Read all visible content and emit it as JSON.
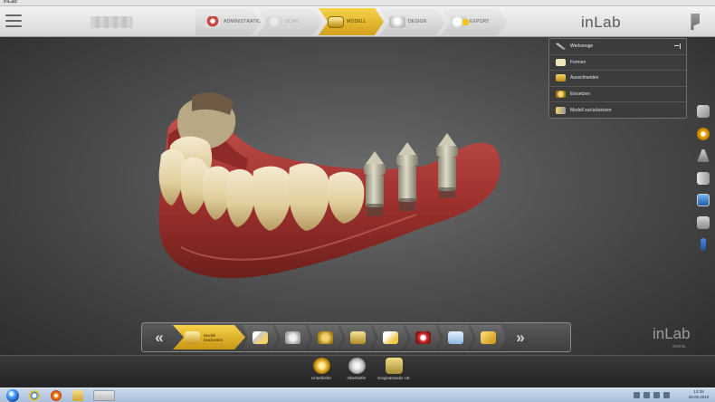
{
  "window": {
    "title": "inLab"
  },
  "header": {
    "brand": "inLab",
    "phases": [
      {
        "id": "administration",
        "label": "ADMINISTRATION",
        "state": "normal",
        "icon": "administration-icon"
      },
      {
        "id": "scan",
        "label": "SCAN",
        "state": "disabled",
        "icon": "scan-icon"
      },
      {
        "id": "model",
        "label": "MODELL",
        "state": "active",
        "icon": "model-icon"
      },
      {
        "id": "design",
        "label": "DESIGN",
        "state": "normal",
        "icon": "design-icon"
      },
      {
        "id": "export",
        "label": "EXPORT",
        "state": "normal",
        "icon": "export-icon"
      }
    ]
  },
  "tools_panel": {
    "header": "Werkzeuge",
    "items": [
      {
        "label": "Formen",
        "icon": "shape-tool-icon"
      },
      {
        "label": "Ausschneiden",
        "icon": "cut-tool-icon"
      },
      {
        "label": "Einsetzen",
        "icon": "edge-tool-icon"
      },
      {
        "label": "Modell zurücksetzen",
        "icon": "reset-model-icon"
      }
    ]
  },
  "side_tools": [
    "view-cube-icon",
    "settings-gear-icon",
    "figure-icon",
    "book-icon",
    "screenshot-icon",
    "print-icon",
    "key-icon"
  ],
  "step_bar": {
    "prev": "«",
    "next": "»",
    "active_label": "Modell bearbeiten",
    "steps": [
      "edit-model-icon",
      "trim-model-icon",
      "margin-icon",
      "insertion-axis-icon",
      "die-icon",
      "preparation-icon",
      "shade-icon",
      "articulator-icon",
      "finish-icon"
    ]
  },
  "brand_footer": {
    "main": "inLab",
    "sub": "sirona."
  },
  "lower_bar": {
    "items": [
      {
        "label": "Unterkiefer",
        "state": "active"
      },
      {
        "label": "Oberkiefer",
        "state": "normal"
      },
      {
        "label": "Gingivamaske UK",
        "state": "normal"
      }
    ]
  },
  "taskbar": {
    "time": "13:39",
    "date": "28.06.2019"
  },
  "colors": {
    "accent": "#e8b830",
    "panel": "#3c3c3c",
    "gingiva": "#a83a38",
    "tooth": "#e6d7a8",
    "abutment": "#b9b5a4"
  }
}
